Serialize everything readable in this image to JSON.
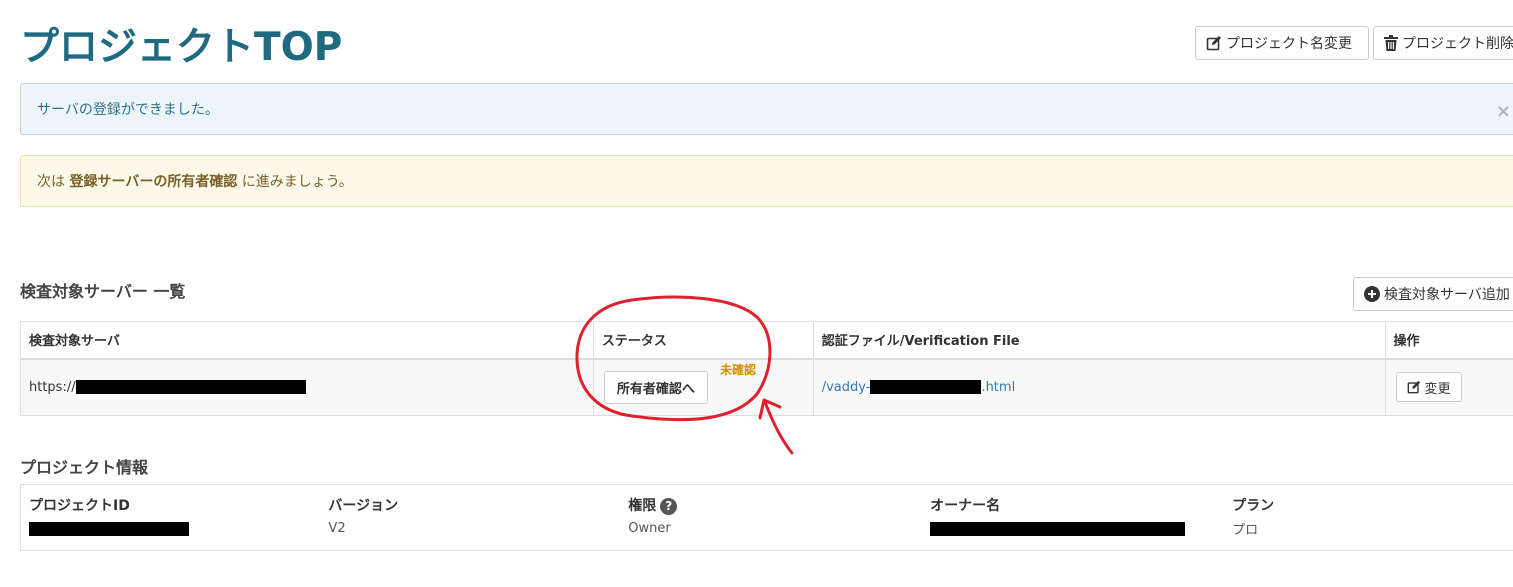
{
  "header": {
    "title": "プロジェクトTOP",
    "rename_button": "プロジェクト名変更",
    "delete_button": "プロジェクト削除"
  },
  "alerts": {
    "success_message": "サーバの登録ができました。",
    "close_symbol": "×",
    "next_prefix": "次は ",
    "next_emphasis": "登録サーバーの所有者確認",
    "next_suffix": " に進みましょう。"
  },
  "servers": {
    "title": "検査対象サーバー 一覧",
    "add_button": "検査対象サーバ追加",
    "columns": [
      "検査対象サーバ",
      "ステータス",
      "認証ファイル/Verification File",
      "操作"
    ],
    "rows": [
      {
        "url_prefix": "https://",
        "verify_button": "所有者確認へ",
        "status": "未確認",
        "file_prefix": "/vaddy-",
        "file_suffix": ".html",
        "edit_button": "変更"
      }
    ]
  },
  "project": {
    "title": "プロジェクト情報",
    "columns": [
      "プロジェクトID",
      "バージョン",
      "権限",
      "オーナー名",
      "プラン"
    ],
    "help_symbol": "?",
    "values": {
      "version": "V2",
      "role": "Owner",
      "plan": "プロ"
    }
  },
  "colors": {
    "title": "#1f6a80",
    "status_warning": "#d08e00",
    "link": "#337ab7",
    "annotation": "#e0202e"
  }
}
